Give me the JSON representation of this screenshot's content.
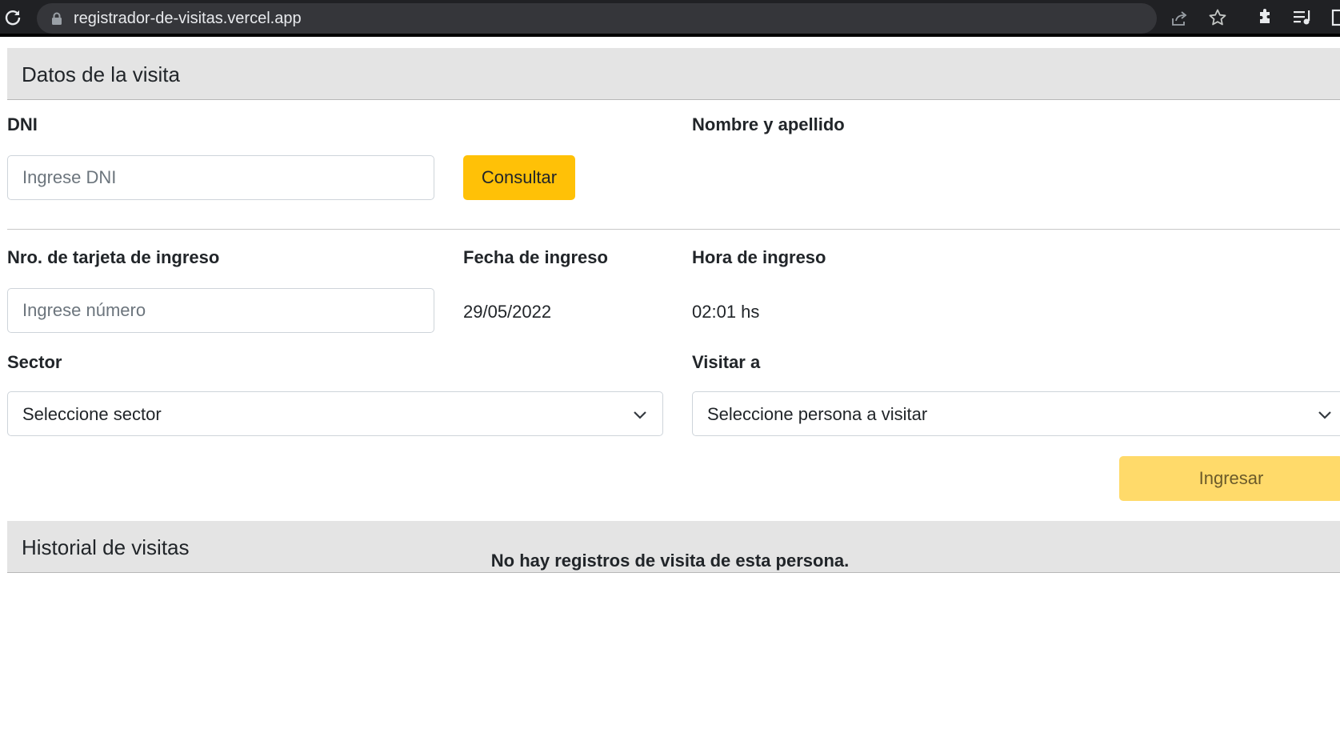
{
  "browser": {
    "url": "registrador-de-visitas.vercel.app"
  },
  "visit_form": {
    "header_title": "Datos de la visita",
    "dni_label": "DNI",
    "dni_placeholder": "Ingrese DNI",
    "consult_button": "Consultar",
    "name_label": "Nombre y apellido",
    "card_label": "Nro. de tarjeta de ingreso",
    "card_placeholder": "Ingrese número",
    "date_label": "Fecha de ingreso",
    "date_value": "29/05/2022",
    "time_label": "Hora de ingreso",
    "time_value": "02:01 hs",
    "sector_label": "Sector",
    "sector_selected": "Seleccione sector",
    "visit_label": "Visitar a",
    "visit_selected": "Seleccione persona a visitar",
    "submit_button": "Ingresar"
  },
  "history": {
    "header_title": "Historial de visitas",
    "empty_message": "No hay registros de visita de esta persona."
  }
}
